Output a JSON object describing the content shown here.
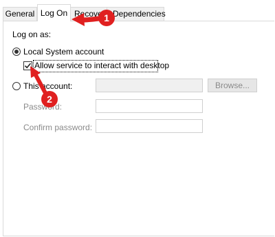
{
  "tabs": [
    {
      "label": "General"
    },
    {
      "label": "Log On"
    },
    {
      "label": "Recovery"
    },
    {
      "label": "Dependencies"
    }
  ],
  "logon": {
    "section_label": "Log on as:",
    "local_system": {
      "label": "Local System account",
      "selected": true
    },
    "interact_desktop": {
      "label": "Allow service to interact with desktop",
      "checked": true
    },
    "this_account": {
      "label": "This account:",
      "value": "",
      "browse_label": "Browse..."
    },
    "password": {
      "label": "Password:",
      "value": ""
    },
    "confirm_password": {
      "label": "Confirm password:",
      "value": ""
    }
  },
  "annotations": [
    {
      "number": "1"
    },
    {
      "number": "2"
    }
  ],
  "colors": {
    "annotation_red": "#e02020"
  }
}
